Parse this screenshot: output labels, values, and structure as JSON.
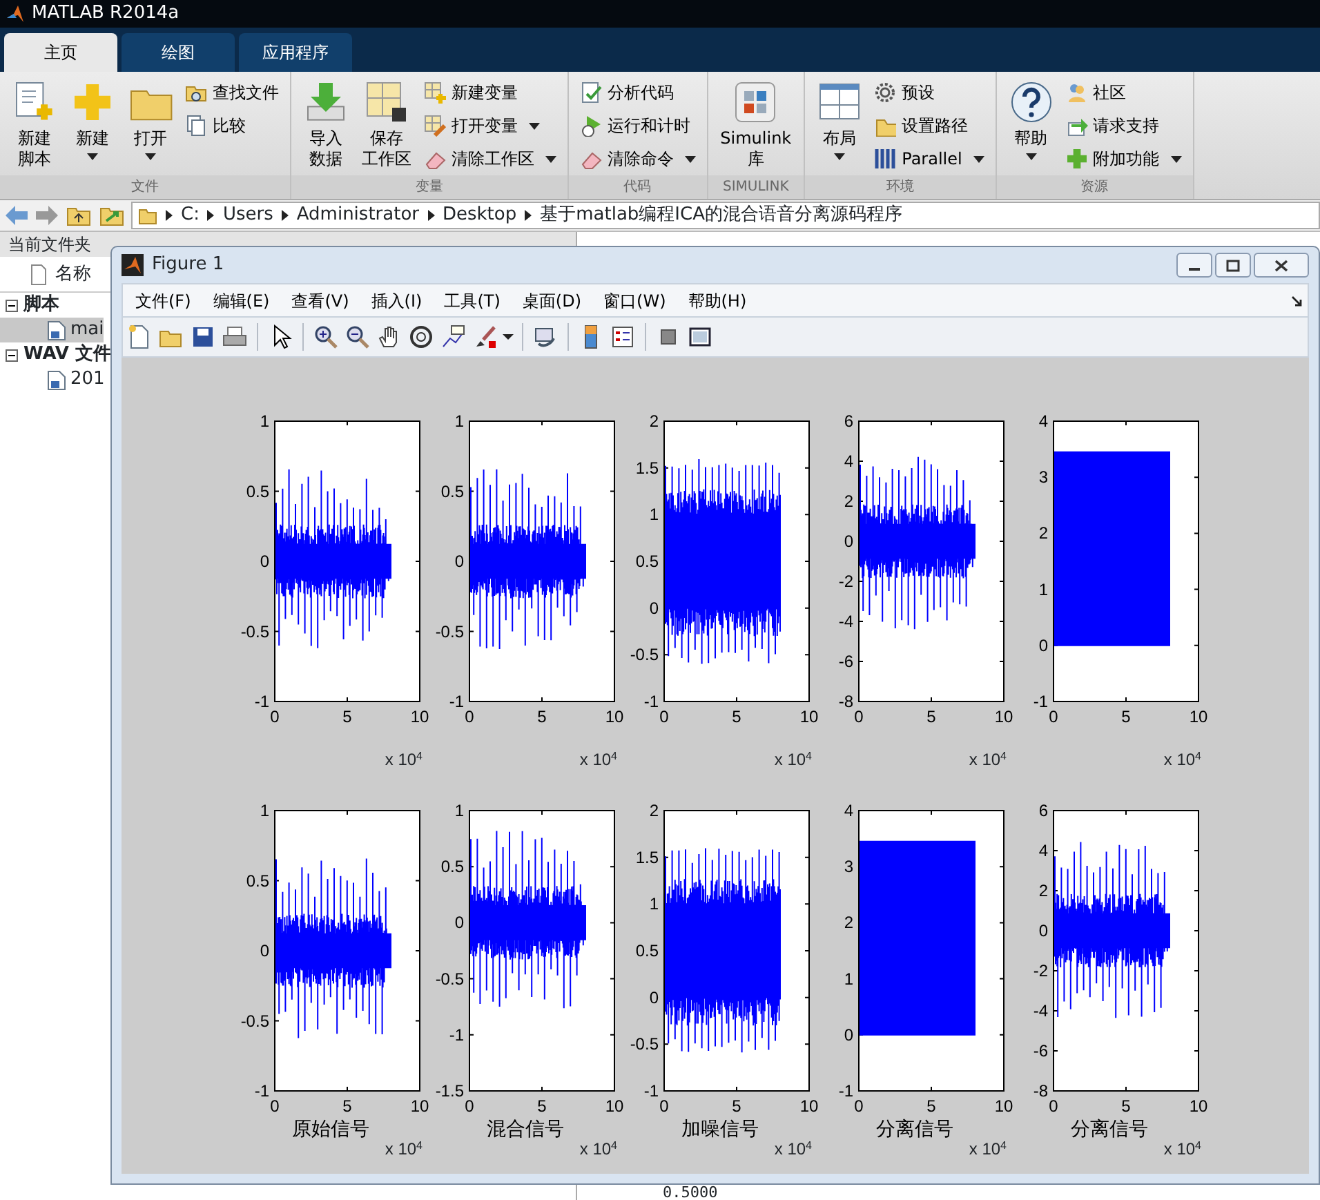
{
  "window": {
    "title": "MATLAB R2014a"
  },
  "ribbon": {
    "tabs": [
      {
        "label": "主页",
        "selected": true
      },
      {
        "label": "绘图",
        "selected": false
      },
      {
        "label": "应用程序",
        "selected": false
      }
    ],
    "groups": [
      {
        "label": "文件",
        "large": [
          {
            "lines": [
              "新建",
              "脚本"
            ],
            "dropdown": false
          },
          {
            "lines": [
              "新建"
            ],
            "dropdown": true
          },
          {
            "lines": [
              "打开"
            ],
            "dropdown": true
          }
        ],
        "small": [
          {
            "label": "查找文件",
            "dropdown": false
          },
          {
            "label": "比较",
            "dropdown": false
          }
        ]
      },
      {
        "label": "变量",
        "large": [
          {
            "lines": [
              "导入",
              "数据"
            ],
            "dropdown": false
          },
          {
            "lines": [
              "保存",
              "工作区"
            ],
            "dropdown": false
          }
        ],
        "small": [
          {
            "label": "新建变量",
            "dropdown": false
          },
          {
            "label": "打开变量",
            "dropdown": true
          },
          {
            "label": "清除工作区",
            "dropdown": true
          }
        ]
      },
      {
        "label": "代码",
        "small": [
          {
            "label": "分析代码",
            "dropdown": false
          },
          {
            "label": "运行和计时",
            "dropdown": false
          },
          {
            "label": "清除命令",
            "dropdown": true
          }
        ]
      },
      {
        "label": "SIMULINK",
        "large": [
          {
            "lines": [
              "Simulink",
              "库"
            ],
            "dropdown": false
          }
        ]
      },
      {
        "label": "环境",
        "large": [
          {
            "lines": [
              "布局"
            ],
            "dropdown": true
          }
        ],
        "small": [
          {
            "label": "预设",
            "dropdown": false
          },
          {
            "label": "设置路径",
            "dropdown": false
          },
          {
            "label": "Parallel",
            "dropdown": true
          }
        ]
      },
      {
        "label": "资源",
        "large": [
          {
            "lines": [
              "帮助"
            ],
            "dropdown": true
          }
        ],
        "small": [
          {
            "label": "社区",
            "dropdown": false
          },
          {
            "label": "请求支持",
            "dropdown": false
          },
          {
            "label": "附加功能",
            "dropdown": true
          }
        ]
      }
    ]
  },
  "address_bar": {
    "path": [
      "C:",
      "Users",
      "Administrator",
      "Desktop",
      "基于matlab编程ICA的混合语音分离源码程序"
    ]
  },
  "current_folder": {
    "title": "当前文件夹",
    "column": "名称",
    "groups": [
      {
        "label": "脚本",
        "expanded": true,
        "children": [
          {
            "label": "mai",
            "selected": true
          }
        ]
      },
      {
        "label": "WAV 文件",
        "expanded": true,
        "children": [
          {
            "label": "201",
            "selected": false
          }
        ]
      }
    ]
  },
  "command_window": {
    "lines": [
      "0.5000"
    ]
  },
  "figure": {
    "title": "Figure 1",
    "menus": [
      "文件(F)",
      "编辑(E)",
      "查看(V)",
      "插入(I)",
      "工具(T)",
      "桌面(D)",
      "窗口(W)",
      "帮助(H)"
    ],
    "subplots": [
      {
        "kind": "burst",
        "yticks": [
          "1",
          "0.5",
          "0",
          "-0.5",
          "-1"
        ],
        "xticks": [
          "0",
          "5",
          "10"
        ],
        "exponent": "x 10$^{4}$"
      },
      {
        "kind": "burst",
        "yticks": [
          "1",
          "0.5",
          "0",
          "-0.5",
          "-1"
        ],
        "xticks": [
          "0",
          "5",
          "10"
        ],
        "exponent": "x 10$^{4}$"
      },
      {
        "kind": "noisy",
        "yticks": [
          "2",
          "1.5",
          "1",
          "0.5",
          "0",
          "-0.5",
          "-1"
        ],
        "xticks": [
          "0",
          "5",
          "10"
        ],
        "exponent": "x 10$^{4}$"
      },
      {
        "kind": "burst",
        "yticks": [
          "6",
          "4",
          "2",
          "0",
          "-2",
          "-4",
          "-6",
          "-8"
        ],
        "xticks": [
          "0",
          "5",
          "10"
        ],
        "exponent": "x 10$^{4}$"
      },
      {
        "kind": "block",
        "yticks": [
          "4",
          "3",
          "2",
          "1",
          "0",
          "-1"
        ],
        "xticks": [
          "0",
          "5",
          "10"
        ],
        "exponent": "x 10$^{4}$"
      },
      {
        "kind": "burst",
        "yticks": [
          "1",
          "0.5",
          "0",
          "-0.5",
          "-1"
        ],
        "xticks": [
          "0",
          "5",
          "10"
        ],
        "xlabel": "原始信号",
        "exponent": "x 10$^{4}$"
      },
      {
        "kind": "burst",
        "yticks": [
          "1",
          "0.5",
          "0",
          "-0.5",
          "-1",
          "-1.5"
        ],
        "xticks": [
          "0",
          "5",
          "10"
        ],
        "xlabel": "混合信号",
        "exponent": "x 10$^{4}$"
      },
      {
        "kind": "noisy",
        "yticks": [
          "2",
          "1.5",
          "1",
          "0.5",
          "0",
          "-0.5",
          "-1"
        ],
        "xticks": [
          "0",
          "5",
          "10"
        ],
        "xlabel": "加噪信号",
        "exponent": "x 10$^{4}$"
      },
      {
        "kind": "block",
        "yticks": [
          "4",
          "3",
          "2",
          "1",
          "0",
          "-1"
        ],
        "xticks": [
          "0",
          "5",
          "10"
        ],
        "xlabel": "分离信号",
        "exponent": "x 10$^{4}$"
      },
      {
        "kind": "burst",
        "yticks": [
          "6",
          "4",
          "2",
          "0",
          "-2",
          "-4",
          "-6",
          "-8"
        ],
        "xticks": [
          "0",
          "5",
          "10"
        ],
        "xlabel": "分离信号",
        "exponent": "x 10$^{4}$"
      }
    ]
  }
}
